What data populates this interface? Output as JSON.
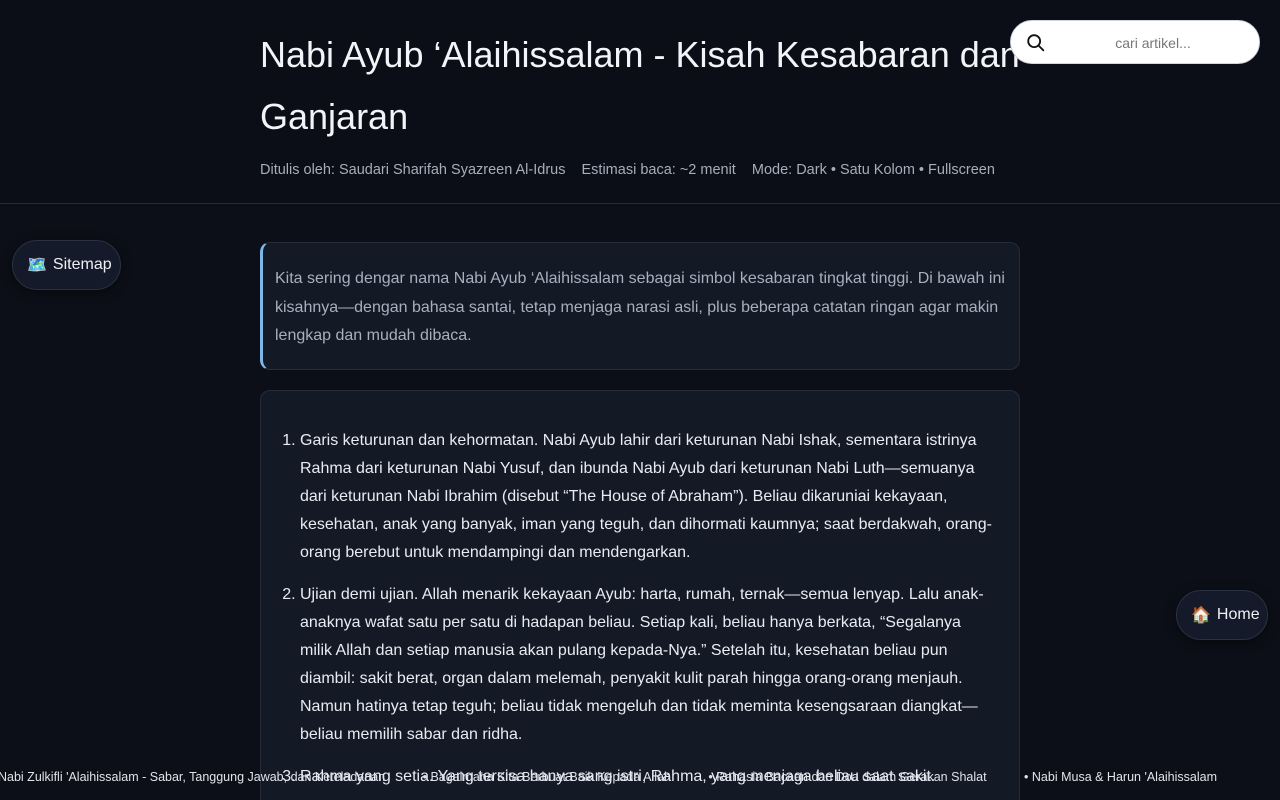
{
  "article": {
    "title": "Nabi Ayub ‘Alaihissalam - Kisah Kesabaran dan Ganjaran",
    "author": "Ditulis oleh: Saudari Sharifah Syazreen Al-Idrus",
    "read_time": "Estimasi baca: ~2 menit",
    "mode": "Mode: Dark • Satu Kolom • Fullscreen",
    "intro": "Kita sering dengar nama Nabi Ayub ‘Alaihissalam sebagai simbol kesabaran tingkat tinggi. Di bawah ini kisahnya—dengan bahasa santai, tetap menjaga narasi asli, plus beberapa catatan ringan agar makin lengkap dan mudah dibaca.",
    "points": [
      "Garis keturunan dan kehormatan. Nabi Ayub lahir dari keturunan Nabi Ishak, sementara istrinya Rahma dari keturunan Nabi Yusuf, dan ibunda Nabi Ayub dari keturunan Nabi Luth—semuanya dari keturunan Nabi Ibrahim (disebut “The House of Abraham”). Beliau dikaruniai kekayaan, kesehatan, anak yang banyak, iman yang teguh, dan dihormati kaumnya; saat berdakwah, orang-orang berebut untuk mendampingi dan mendengarkan.",
      "Ujian demi ujian. Allah menarik kekayaan Ayub: harta, rumah, ternak—semua lenyap. Lalu anak-anaknya wafat satu per satu di hadapan beliau. Setiap kali, beliau hanya berkata, “Segalanya milik Allah dan setiap manusia akan pulang kepada-Nya.” Setelah itu, kesehatan beliau pun diambil: sakit berat, organ dalam melemah, penyakit kulit parah hingga orang-orang menjauh. Namun hatinya tetap teguh; beliau tidak mengeluh dan tidak meminta kesengsaraan diangkat—beliau memilih sabar dan ridha.",
      "Rahma yang setia. Yang tersisa hanya sang istri, Rahma, yang menjaga beliau saat sakit."
    ]
  },
  "search": {
    "placeholder": "cari artikel...",
    "icon": "search-icon"
  },
  "nav": {
    "sitemap_label": "Sitemap",
    "sitemap_icon": "🗺️",
    "home_label": "Home",
    "home_icon": "🏠"
  },
  "ticker": [
    "Nabi Zulkifli 'Alaihissalam - Sabar, Tanggung Jawab, dan Keteladanan",
    "• Bagaimana Kita Berbuat Baik Kepada Allah",
    "• Rahasia Bacaan dan Doa dalam Gerakan Shalat",
    "• Nabi Musa & Harun 'Alaihissalam"
  ]
}
